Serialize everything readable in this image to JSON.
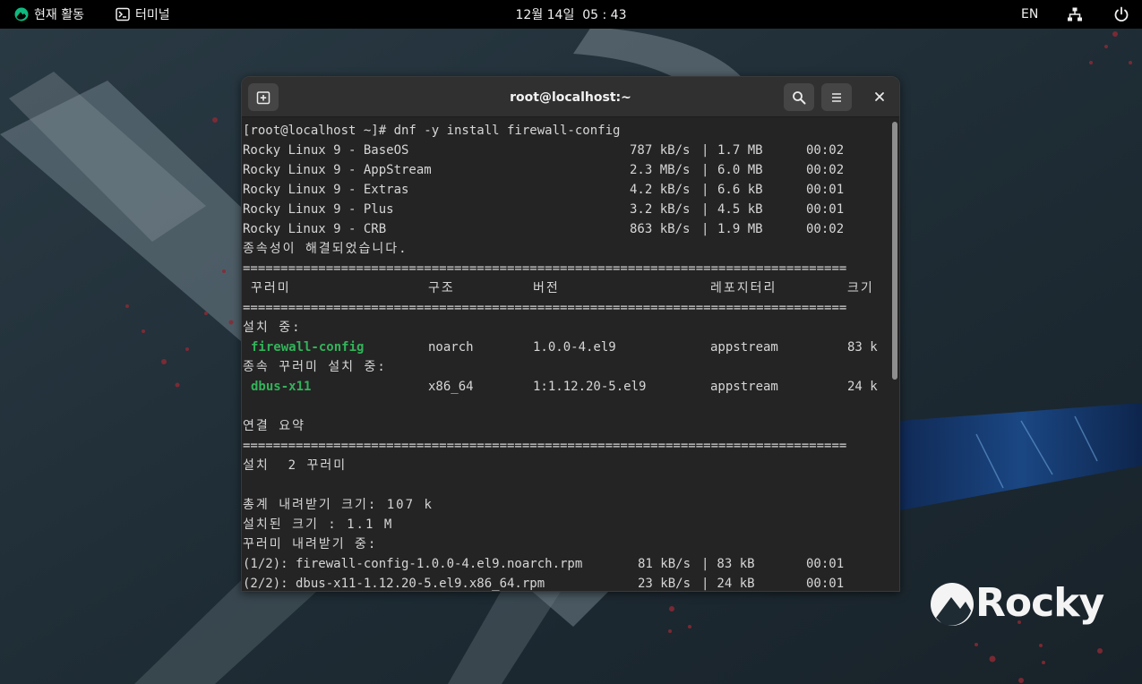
{
  "topbar": {
    "activities_label": "현재 활동",
    "app_label": "터미널",
    "clock": "12월 14일  05 : 43",
    "lang": "EN",
    "icons": {
      "activities": "rocky-logo-icon",
      "app": "terminal-icon",
      "network": "network-wired-icon",
      "power": "power-icon"
    }
  },
  "window": {
    "title": "root@localhost:~",
    "icons": {
      "new_tab": "new-tab-icon",
      "search": "search-icon",
      "menu": "hamburger-menu-icon",
      "close": "close-icon"
    }
  },
  "terminal": {
    "prompt_line": "[root@localhost ~]# dnf -y install firewall-config",
    "repos": [
      {
        "name": "Rocky Linux 9 - BaseOS",
        "speed": "787 kB/s",
        "size": "1.7 MB",
        "time": "00:02"
      },
      {
        "name": "Rocky Linux 9 - AppStream",
        "speed": "2.3 MB/s",
        "size": "6.0 MB",
        "time": "00:02"
      },
      {
        "name": "Rocky Linux 9 - Extras",
        "speed": "4.2 kB/s",
        "size": "6.6 kB",
        "time": "00:01"
      },
      {
        "name": "Rocky Linux 9 - Plus",
        "speed": "3.2 kB/s",
        "size": "4.5 kB",
        "time": "00:01"
      },
      {
        "name": "Rocky Linux 9 - CRB",
        "speed": "863 kB/s",
        "size": "1.9 MB",
        "time": "00:02"
      }
    ],
    "deps_resolved": "종속성이 해결되었습니다.",
    "separator": "================================================================================",
    "table_headers": {
      "package": "꾸러미",
      "arch": "구조",
      "version": "버전",
      "repo": "레포지터리",
      "size": "크기"
    },
    "installing_label": "설치 중:",
    "install_packages": [
      {
        "name": "firewall-config",
        "arch": "noarch",
        "version": "1.0.0-4.el9",
        "repo": "appstream",
        "size": "83 k"
      }
    ],
    "dep_install_label": "종속 꾸러미 설치 중:",
    "dep_packages": [
      {
        "name": "dbus-x11",
        "arch": "x86_64",
        "version": "1:1.12.20-5.el9",
        "repo": "appstream",
        "size": "24 k"
      }
    ],
    "summary_label": "연결 요약",
    "install_count": "설치  2 꾸러미",
    "total_download": "총계 내려받기 크기: 107 k",
    "installed_size": "설치된 크기 : 1.1 M",
    "downloading_label": "꾸러미 내려받기 중:",
    "downloads": [
      {
        "name": "(1/2): firewall-config-1.0.0-4.el9.noarch.rpm",
        "speed": "81 kB/s",
        "size": " 83 kB",
        "time": "00:01"
      },
      {
        "name": "(2/2): dbus-x11-1.12.20-5.el9.x86_64.rpm",
        "speed": "23 kB/s",
        "size": " 24 kB",
        "time": "00:01"
      }
    ]
  },
  "desktop": {
    "brand": "Rocky",
    "icons": {
      "brand": "rocky-logo-icon"
    }
  },
  "colors": {
    "topbar_bg": "#000000",
    "terminal_bg": "#242424",
    "headerbar_bg": "#303030",
    "package_name": "#33b35a",
    "terminal_text": "#d6d6d6"
  }
}
